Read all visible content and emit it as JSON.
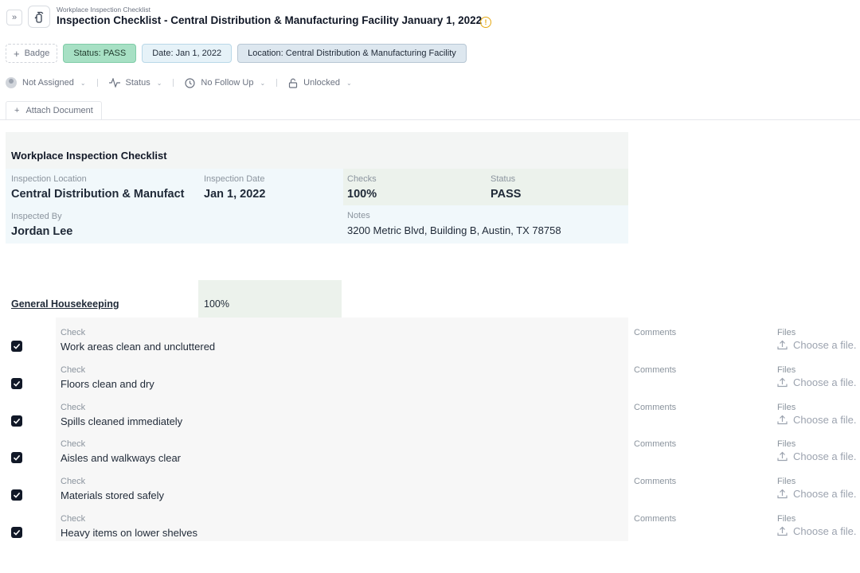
{
  "header": {
    "breadcrumb": "Workplace Inspection Checklist",
    "title": "Inspection Checklist - Central Distribution & Manufacturing Facility January 1, 2022"
  },
  "badges": {
    "add_label": "Badge",
    "status": "Status: PASS",
    "date": "Date: Jan 1, 2022",
    "location": "Location: Central Distribution & Manufacturing Facility"
  },
  "properties": {
    "assignee": "Not Assigned",
    "status": "Status",
    "follow_up": "No Follow Up",
    "lock": "Unlocked"
  },
  "attach_label": "Attach Document",
  "summary": {
    "title": "Workplace Inspection Checklist",
    "location_label": "Inspection Location",
    "location_value": "Central Distribution & Manufact",
    "date_label": "Inspection Date",
    "date_value": "Jan 1, 2022",
    "checks_label": "Checks",
    "checks_value": "100%",
    "status_label": "Status",
    "status_value": "PASS",
    "inspector_label": "Inspected By",
    "inspector_value": "Jordan Lee",
    "notes_label": "Notes",
    "notes_value": "3200 Metric Blvd, Building B, Austin, TX 78758"
  },
  "section": {
    "name": "General Housekeeping",
    "percent": "100%",
    "check_label": "Check",
    "comments_label": "Comments",
    "files_label": "Files",
    "choose_label": "Choose a file.",
    "items": [
      {
        "text": " Work areas clean and uncluttered",
        "checked": true
      },
      {
        "text": "Floors clean and dry",
        "checked": true
      },
      {
        "text": "Spills cleaned immediately",
        "checked": true
      },
      {
        "text": "Aisles and walkways clear",
        "checked": true
      },
      {
        "text": "Materials stored safely",
        "checked": true
      },
      {
        "text": "Heavy items on lower shelves",
        "checked": true
      }
    ]
  },
  "colors": {
    "pass_badge": "#a7e0c4",
    "date_badge": "#e6f2f8",
    "location_badge": "#dde7ef",
    "warning": "#e5a812"
  }
}
